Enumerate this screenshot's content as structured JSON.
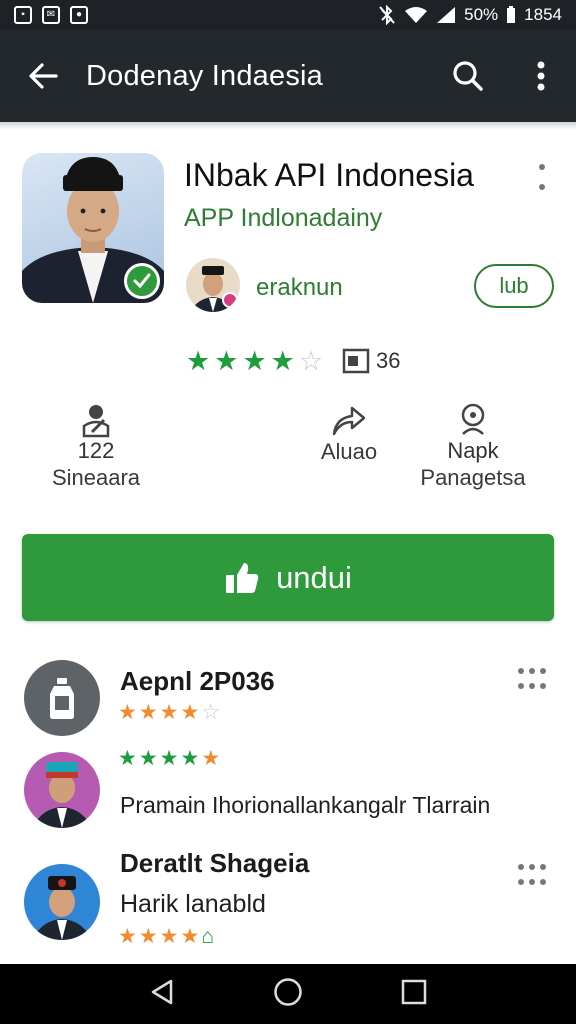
{
  "status_bar": {
    "battery": "50%",
    "time": "1854"
  },
  "app_bar": {
    "title": "Dodenay Indaesia"
  },
  "app": {
    "name": "INbak API Indonesia",
    "subtitle": "APP Indlonadainy",
    "developer": "eraknun",
    "pill_button": "lub",
    "rating_stars": 4,
    "reviews_count": "36"
  },
  "stats": [
    {
      "value": "122",
      "label": "Sineaara",
      "icon": "user-edit-icon"
    },
    {
      "value": "",
      "label": "Aluao",
      "icon": "share-icon"
    },
    {
      "value": "Napk",
      "label": "Panagetsa",
      "icon": "person-icon"
    }
  ],
  "install_button": {
    "label": "undui",
    "icon": "thumbs-up-icon"
  },
  "reviews": [
    {
      "name": "Aepnl 2P036",
      "stars": 4,
      "text": ""
    },
    {
      "name": "",
      "stars": 5,
      "text": "Pramain Ihorionallankangalr Tlarrain"
    },
    {
      "name": "Deratlt Shageia",
      "stars": 4,
      "text": "Harik lanabld"
    }
  ],
  "colors": {
    "accent_green": "#2e9a3c",
    "app_bar": "#23282c",
    "star_orange": "#f28a2e"
  }
}
